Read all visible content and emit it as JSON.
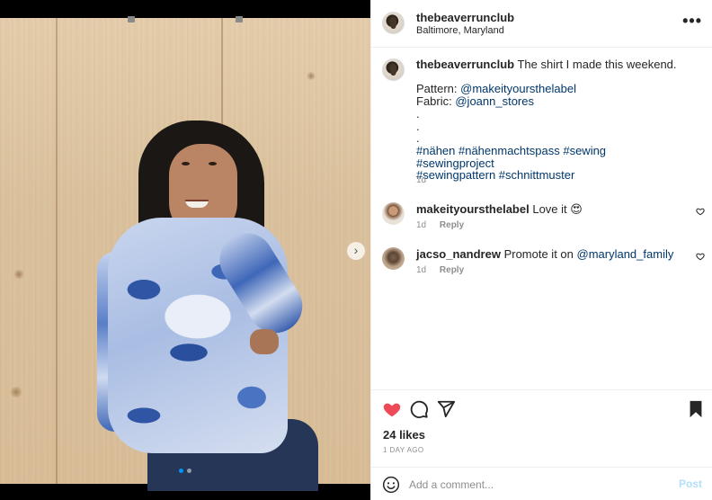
{
  "post": {
    "username": "thebeaverrunclub",
    "location": "Baltimore, Maryland",
    "more_icon": "more-horizontal-icon",
    "more_label": "•••",
    "photo_position": "1 of 2",
    "caption": {
      "text": "The shirt I made this weekend.",
      "pattern_label": "Pattern:",
      "pattern_link": "@makeityoursthelabel",
      "fabric_label": "Fabric:",
      "fabric_link": "@joann_stores",
      "dot1": ".",
      "dot2": ".",
      "dot3": ".",
      "hashtags_line1": "#nähen #nähenmachtspass #sewing #sewingproject",
      "hashtags_line2": "#sewingpattern #schnittmuster",
      "age": "1d"
    }
  },
  "comments": [
    {
      "username": "makeityoursthelabel",
      "text": "Love it 😍",
      "mention": "",
      "age": "1d",
      "reply_label": "Reply"
    },
    {
      "username": "jacso_nandrew",
      "text": "Promote it on ",
      "mention": "@maryland_family",
      "age": "1d",
      "reply_label": "Reply"
    }
  ],
  "actions": {
    "like_icon": "heart-filled-icon",
    "comment_icon": "comment-icon",
    "share_icon": "share-icon",
    "save_icon": "bookmark-filled-icon",
    "like_color": "#ed4956",
    "likes": "24 likes",
    "time_ago": "1 DAY AGO"
  },
  "add_comment": {
    "emoji_icon": "smiley-icon",
    "placeholder": "Add a comment...",
    "post_label": "Post",
    "post_color": "#b2dffc"
  },
  "carousel": {
    "next_label": "›",
    "active_dot_color": "#0095f6"
  }
}
